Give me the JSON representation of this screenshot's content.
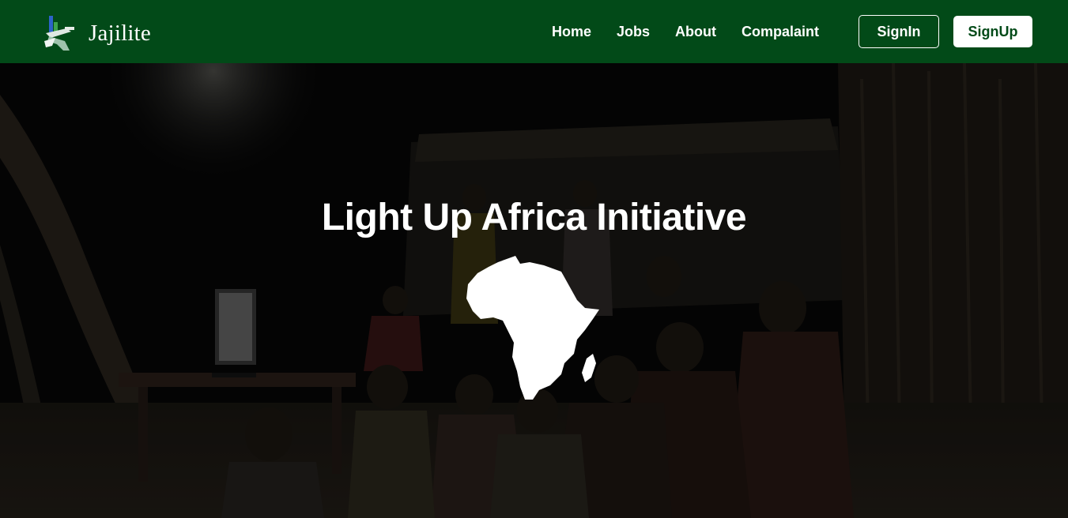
{
  "brand": {
    "name": "Jajilite",
    "logo_icon": "jajilite-logo-icon"
  },
  "nav": {
    "links": [
      "Home",
      "Jobs",
      "About",
      "Compalaint"
    ],
    "signin_label": "SignIn",
    "signup_label": "SignUp"
  },
  "hero": {
    "title": "Light Up Africa Initiative",
    "map_icon": "africa-map-icon",
    "background": "night-village-screen-photo"
  },
  "colors": {
    "navbar": "#024a18",
    "text_light": "#ffffff",
    "signup_text": "#024a18"
  }
}
